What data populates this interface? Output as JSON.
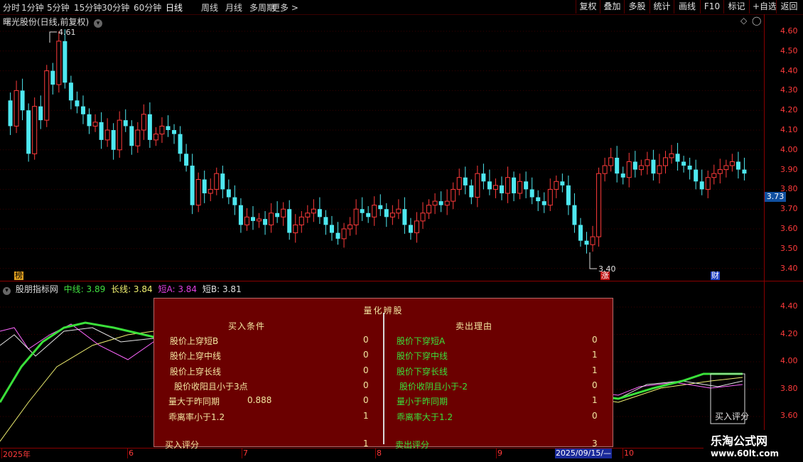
{
  "toolbar": {
    "periods": [
      "分时",
      "1分钟",
      "5分钟",
      "15分钟",
      "30分钟",
      "60分钟",
      "日线",
      "周线",
      "月线",
      "多周期",
      "更多 >"
    ],
    "active_period": "日线",
    "buttons": [
      "复权",
      "叠加",
      "多股",
      "统计",
      "画线",
      "F10",
      "标记",
      "+自选",
      "返回"
    ]
  },
  "main": {
    "title": "曙光股份(日线,前复权)",
    "high_label": "4.61",
    "low_label": "3.40",
    "price_axis": [
      "4.60",
      "4.50",
      "4.40",
      "4.30",
      "4.20",
      "4.10",
      "4.00",
      "3.90",
      "3.80",
      "3.70",
      "3.60",
      "3.50",
      "3.40"
    ],
    "current_price": "3.73",
    "markers": [
      {
        "text": "榜",
        "color": "#e0a020"
      },
      {
        "text": "涨",
        "color": "#ff4040"
      },
      {
        "text": "财",
        "color": "#4060ff"
      }
    ]
  },
  "indicator": {
    "name": "股朋指标网",
    "values": [
      {
        "text": "中线: 3.89",
        "color": "#40e040"
      },
      {
        "text": "长线: 3.84",
        "color": "#f0f070"
      },
      {
        "text": "短A: 3.84",
        "color": "#e040e0"
      },
      {
        "text": "短B: 3.81",
        "color": "#e0e0e0"
      }
    ],
    "axis": [
      "4.40",
      "4.20",
      "4.00",
      "3.80",
      "3.60"
    ],
    "buy_score_label": "买入评分"
  },
  "date_axis": {
    "labels": [
      "2025年",
      "6",
      "7",
      "8",
      "9",
      "10"
    ],
    "highlight": "2025/09/15/—"
  },
  "quant_panel": {
    "title": "量化辨股",
    "buy_header": "买入条件",
    "sell_header": "卖出理由",
    "buy_rows": [
      {
        "label": "股价上穿短B",
        "extra": "",
        "value": "0"
      },
      {
        "label": "股价上穿中线",
        "extra": "",
        "value": "0"
      },
      {
        "label": "股价上穿长线",
        "extra": "",
        "value": "0"
      },
      {
        "label": "股价收阳且小于3点",
        "extra": "",
        "value": "0"
      },
      {
        "label": "量大于昨同期",
        "extra": "0.888",
        "value": "0"
      },
      {
        "label": "乖离率小于1.2",
        "extra": "",
        "value": "1"
      },
      {
        "label": "买入评分",
        "extra": "",
        "value": "1"
      }
    ],
    "sell_rows": [
      {
        "label": "股价下穿短A",
        "value": "0"
      },
      {
        "label": "股价下穿中线",
        "value": "1"
      },
      {
        "label": "股价下穿长线",
        "value": "1"
      },
      {
        "label": "股价收阴且小于-2",
        "value": "0"
      },
      {
        "label": "量小于昨同期",
        "value": "1"
      },
      {
        "label": "乖离率大于1.2",
        "value": "0"
      },
      {
        "label": "卖出评分",
        "value": "3"
      }
    ]
  },
  "watermark": {
    "name": "乐淘公式网",
    "url": "www.60lt.com"
  },
  "colors": {
    "up": "#ff3b3b",
    "down": "#4ee8f0",
    "grid": "#8a0000",
    "panel_bg": "#6b0000"
  }
}
